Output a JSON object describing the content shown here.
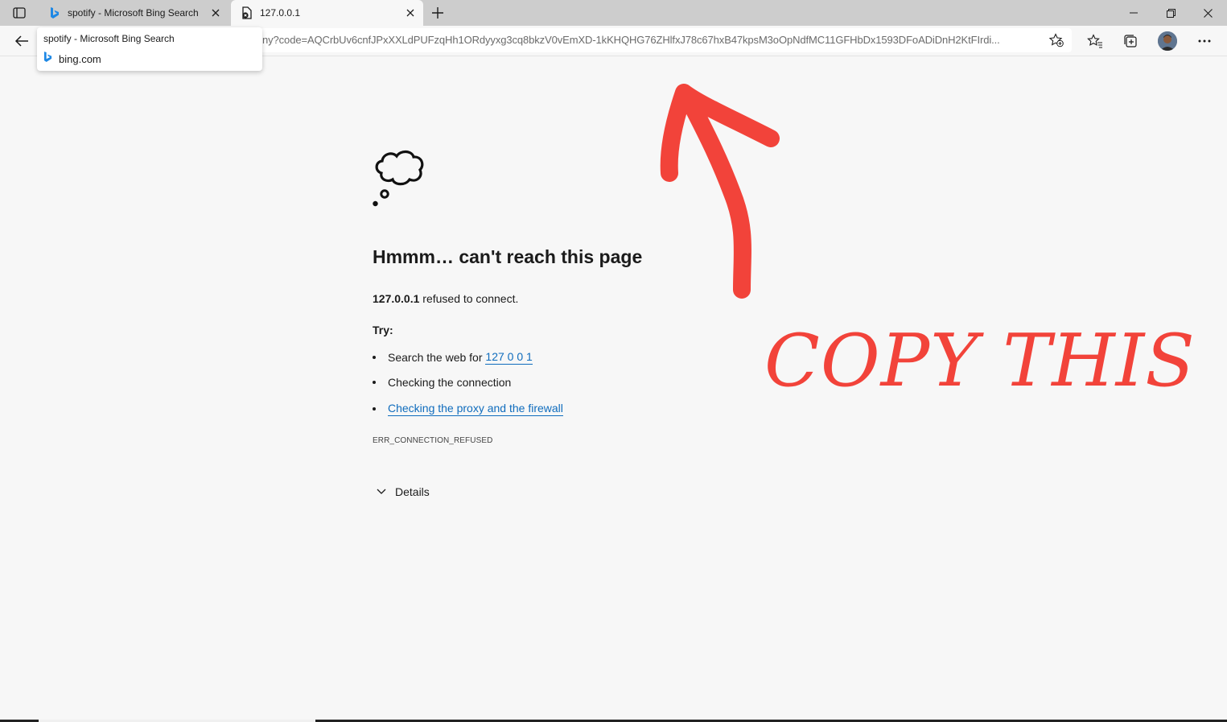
{
  "tabs": [
    {
      "title": "spotify - Microsoft Bing Search",
      "favicon": "bing-icon",
      "active": false
    },
    {
      "title": "127.0.0.1",
      "favicon": "document-error-icon",
      "active": true
    }
  ],
  "hover_card": {
    "title": "spotify - Microsoft Bing Search",
    "domain": "bing.com"
  },
  "address_bar": {
    "url": "ny?code=AQCrbUv6cnfJPxXXLdPUFzqHh1ORdyyxg3cq8bkzV0vEmXD-1kKHQHG76ZHlfxJ78c67hxB47kpsM3oOpNdfMC11GFHbDx1593DFoADiDnH2KtFIrdi..."
  },
  "error_page": {
    "heading": "Hmmm… can't reach this page",
    "host": "127.0.0.1",
    "message_suffix": " refused to connect.",
    "try_label": "Try:",
    "suggestion_search_prefix": "Search the web for ",
    "suggestion_search_link": "127 0 0 1",
    "suggestion_connection": "Checking the connection",
    "suggestion_proxy_link": "Checking the proxy and the firewall",
    "error_code": "ERR_CONNECTION_REFUSED",
    "details_label": "Details"
  },
  "annotation": {
    "text": "COPY THIS",
    "color": "#f2433a"
  },
  "colors": {
    "link": "#0f6cbd",
    "bing": "#1e88e5",
    "tabstrip": "#cdcdcd",
    "page_bg": "#f7f7f7"
  }
}
